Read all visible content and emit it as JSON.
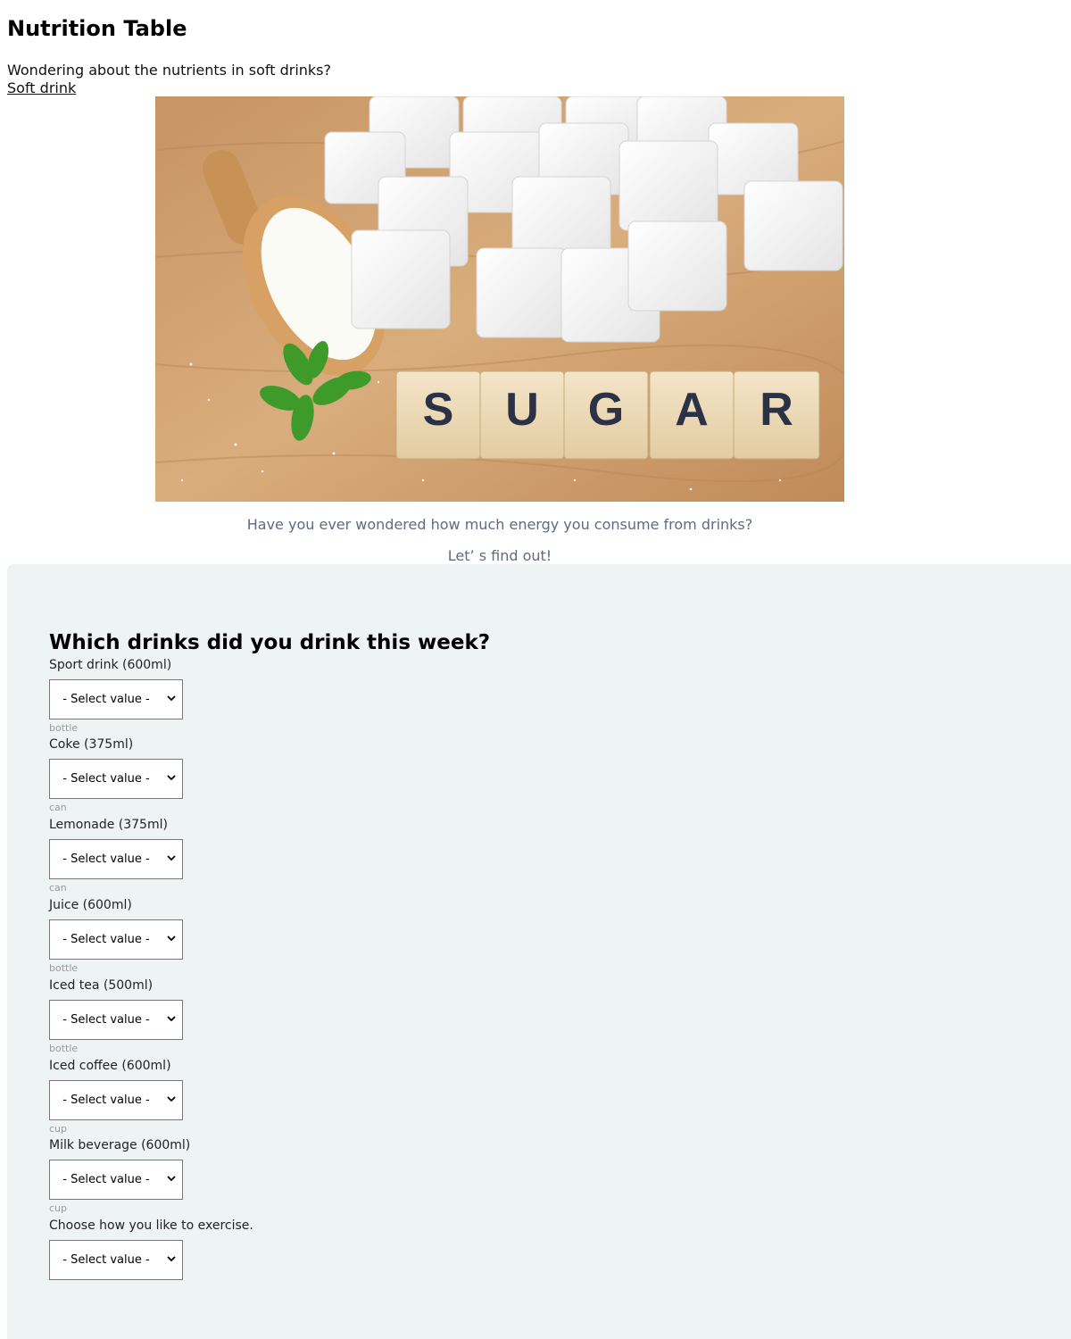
{
  "page": {
    "title": "Nutrition Table",
    "intro": "Wondering about the nutrients in soft drinks?",
    "link": "Soft drink",
    "hero_tiles": [
      "S",
      "U",
      "G",
      "A",
      "R"
    ],
    "caption1": "Have you ever wondered how much energy you consume from drinks?",
    "caption2": "Let’ s find out!"
  },
  "form": {
    "heading": "Which drinks did you drink this week?",
    "select_placeholder": "- Select value -",
    "fields": [
      {
        "label": "Sport drink (600ml)",
        "unit": "bottle"
      },
      {
        "label": "Coke (375ml)",
        "unit": "can"
      },
      {
        "label": "Lemonade (375ml)",
        "unit": "can"
      },
      {
        "label": "Juice (600ml)",
        "unit": "bottle"
      },
      {
        "label": "Iced tea (500ml)",
        "unit": "bottle"
      },
      {
        "label": "Iced coffee (600ml)",
        "unit": "cup"
      },
      {
        "label": "Milk beverage (600ml)",
        "unit": "cup"
      },
      {
        "label": "Choose how you like to exercise.",
        "unit": ""
      }
    ]
  },
  "colors": {
    "panel_bg": "#eef3f3",
    "caption_text": "#5f6b80",
    "unit_text": "#9a9a9a",
    "tile_letter": "#2b3245"
  }
}
